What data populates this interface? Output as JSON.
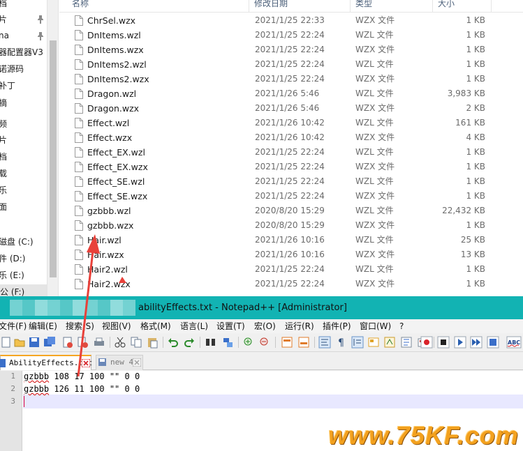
{
  "explorer": {
    "nav_items": [
      "档",
      "片",
      "na",
      "器配置器V3",
      "诺源码",
      "补丁",
      "摘",
      "频",
      "片",
      "档",
      "载",
      "乐",
      "面",
      "磁盘 (C:)",
      "件 (D:)",
      "乐 (E:)",
      "公 (F:)"
    ],
    "columns": {
      "name": "名称",
      "date": "修改日期",
      "type": "类型",
      "size": "大小"
    },
    "files": [
      {
        "name": "ChrSel.wzx",
        "date": "2021/1/25 22:33",
        "type": "WZX 文件",
        "size": "1 KB"
      },
      {
        "name": "DnItems.wzl",
        "date": "2021/1/25 22:24",
        "type": "WZL 文件",
        "size": "1 KB"
      },
      {
        "name": "DnItems.wzx",
        "date": "2021/1/25 22:24",
        "type": "WZX 文件",
        "size": "1 KB"
      },
      {
        "name": "DnItems2.wzl",
        "date": "2021/1/25 22:24",
        "type": "WZL 文件",
        "size": "1 KB"
      },
      {
        "name": "DnItems2.wzx",
        "date": "2021/1/25 22:24",
        "type": "WZX 文件",
        "size": "1 KB"
      },
      {
        "name": "Dragon.wzl",
        "date": "2021/1/26 5:46",
        "type": "WZL 文件",
        "size": "3,983 KB"
      },
      {
        "name": "Dragon.wzx",
        "date": "2021/1/26 5:46",
        "type": "WZX 文件",
        "size": "2 KB"
      },
      {
        "name": "Effect.wzl",
        "date": "2021/1/26 10:42",
        "type": "WZL 文件",
        "size": "161 KB"
      },
      {
        "name": "Effect.wzx",
        "date": "2021/1/26 10:42",
        "type": "WZX 文件",
        "size": "4 KB"
      },
      {
        "name": "Effect_EX.wzl",
        "date": "2021/1/25 22:24",
        "type": "WZL 文件",
        "size": "1 KB"
      },
      {
        "name": "Effect_EX.wzx",
        "date": "2021/1/25 22:24",
        "type": "WZX 文件",
        "size": "1 KB"
      },
      {
        "name": "Effect_SE.wzl",
        "date": "2021/1/25 22:24",
        "type": "WZL 文件",
        "size": "1 KB"
      },
      {
        "name": "Effect_SE.wzx",
        "date": "2021/1/25 22:24",
        "type": "WZX 文件",
        "size": "1 KB"
      },
      {
        "name": "gzbbb.wzl",
        "date": "2020/8/20 15:29",
        "type": "WZL 文件",
        "size": "22,432 KB"
      },
      {
        "name": "gzbbb.wzx",
        "date": "2020/8/20 15:29",
        "type": "WZX 文件",
        "size": "1 KB"
      },
      {
        "name": "Hair.wzl",
        "date": "2021/1/26 10:16",
        "type": "WZL 文件",
        "size": "25 KB"
      },
      {
        "name": "Hair.wzx",
        "date": "2021/1/26 10:16",
        "type": "WZX 文件",
        "size": "13 KB"
      },
      {
        "name": "Hair2.wzl",
        "date": "2021/1/25 22:24",
        "type": "WZL 文件",
        "size": "1 KB"
      },
      {
        "name": "Hair2.wzx",
        "date": "2021/1/25 22:24",
        "type": "WZX 文件",
        "size": "1 KB"
      }
    ]
  },
  "notepad": {
    "title": "abilityEffects.txt - Notepad++ [Administrator]",
    "menu": [
      "文件(F)",
      "编辑(E)",
      "搜索(S)",
      "视图(V)",
      "格式(M)",
      "语言(L)",
      "设置(T)",
      "宏(O)",
      "运行(R)",
      "插件(P)",
      "窗口(W)",
      "?"
    ],
    "tabs": {
      "active": "AbilityEffects.txt",
      "inactive": "new 4"
    },
    "lines": [
      {
        "num": "1",
        "key": "gzbbb",
        "text": " 108 17 100 \"\" 0 0"
      },
      {
        "num": "2",
        "key": "gzbbb",
        "text": " 126 11 100 \"\" 0 0"
      },
      {
        "num": "3",
        "key": "",
        "text": ""
      }
    ]
  },
  "watermark": "www.75KF.com",
  "colors": {
    "title_bar": "#12b3b3",
    "tab_accent": "#f5a623",
    "arrow": "#e8413a",
    "watermark": "#f39c12"
  }
}
